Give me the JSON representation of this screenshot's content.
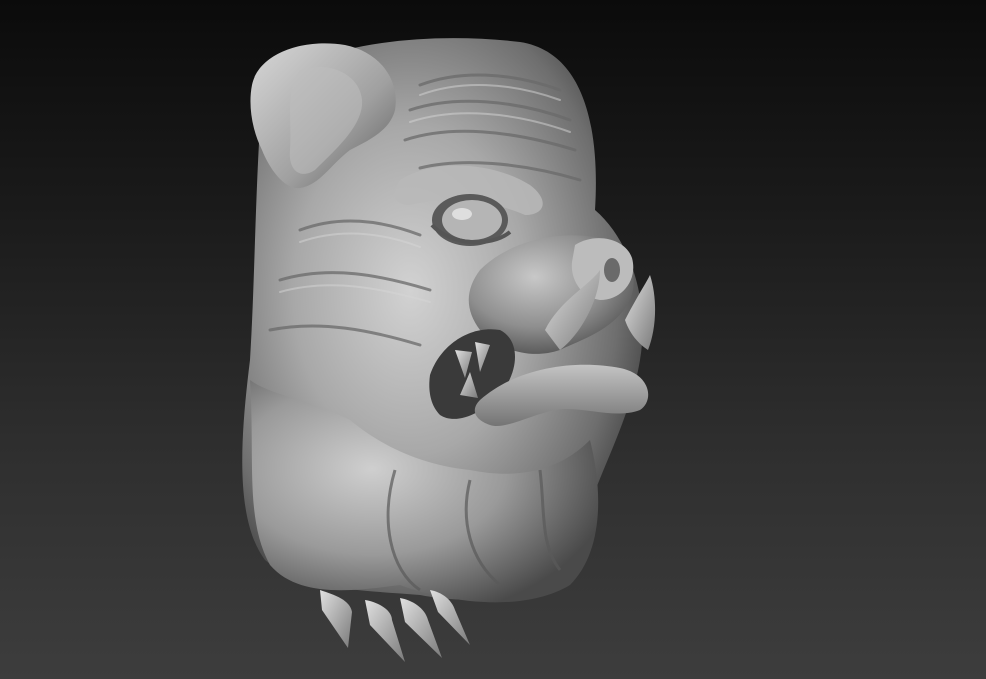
{
  "scene": {
    "subject": "bulldog-head-sculpt",
    "background_top_color": "#0b0b0b",
    "background_bottom_color": "#3d3d3d",
    "material_color": "#a6a6a6"
  }
}
